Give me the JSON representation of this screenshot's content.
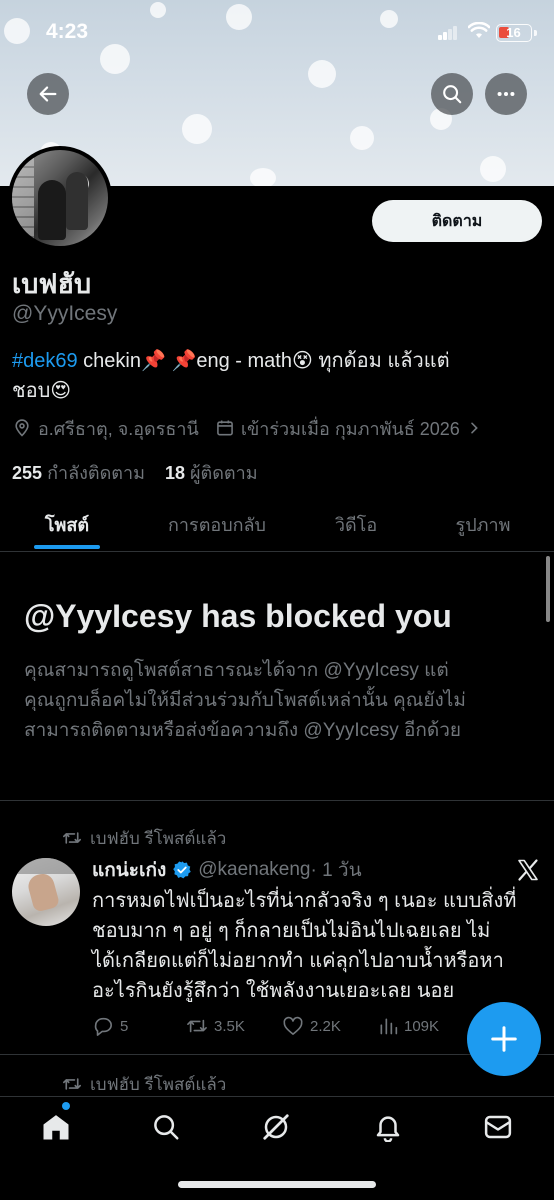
{
  "status_bar": {
    "time": "4:23",
    "battery": "16"
  },
  "header": {
    "back_icon": "arrow-left-icon",
    "search_icon": "search-icon",
    "more_icon": "more-horizontal-icon"
  },
  "profile": {
    "follow_label": "ติดตาม",
    "name": "เบฟฮับ",
    "handle": "@YyyIcesy",
    "bio_hashtag": "#dek69",
    "bio_line1_rest": " chekin📌 📌eng - math😵 ทุกด้อม แล้วแต่",
    "bio_line2": "ชอบ😍",
    "location": "อ.ศรีธาตุ, จ.อุดรธานี",
    "joined": "เข้าร่วมเมื่อ กุมภาพันธ์ 2026",
    "following_count": "255",
    "following_label": "กำลังติดตาม",
    "followers_count": "18",
    "followers_label": "ผู้ติดตาม"
  },
  "tabs": [
    "โพสต์",
    "การตอบกลับ",
    "วิดีโอ",
    "รูปภาพ"
  ],
  "active_tab": "โพสต์",
  "blocked": {
    "title": "@YyyIcesy has blocked you",
    "line1": "คุณสามารถดูโพสต์สาธารณะได้จาก @YyyIcesy แต่",
    "line2": "คุณถูกบล็อคไม่ให้มีส่วนร่วมกับโพสต์เหล่านั้น คุณยังไม่",
    "line3": "สามารถติดตามหรือส่งข้อความถึง @YyyIcesy อีกด้วย"
  },
  "feed": [
    {
      "reposted_by": "เบฟฮับ รีโพสต์แล้ว",
      "author_name": "แกน่ะเก่ง",
      "author_handle": "@kaenakeng",
      "time": "· 1 วัน",
      "text_lines": [
        "การหมดไฟเป็นอะไรที่น่ากลัวจริง ๆ เนอะ แบบสิ่งที่",
        "ชอบมาก ๆ อยู่ ๆ ก็กลายเป็นไม่อินไปเฉยเลย ไม่",
        "ได้เกลียดแต่ก็ไม่อยากทำ แค่ลุกไปอาบน้ำหรือหา",
        "อะไรกินยังรู้สึกว่า ใช้พลังงานเยอะเลย นอย"
      ],
      "replies": "5",
      "reposts": "3.5K",
      "likes": "2.2K",
      "views": "109K"
    },
    {
      "reposted_by": "เบฟฮับ รีโพสต์แล้ว"
    }
  ],
  "colors": {
    "accent": "#1d9bf0",
    "background": "#000000",
    "secondary_text": "#71767b"
  },
  "bottom_nav": [
    "home-icon",
    "search-icon",
    "grok-icon",
    "notifications-icon",
    "messages-icon"
  ]
}
